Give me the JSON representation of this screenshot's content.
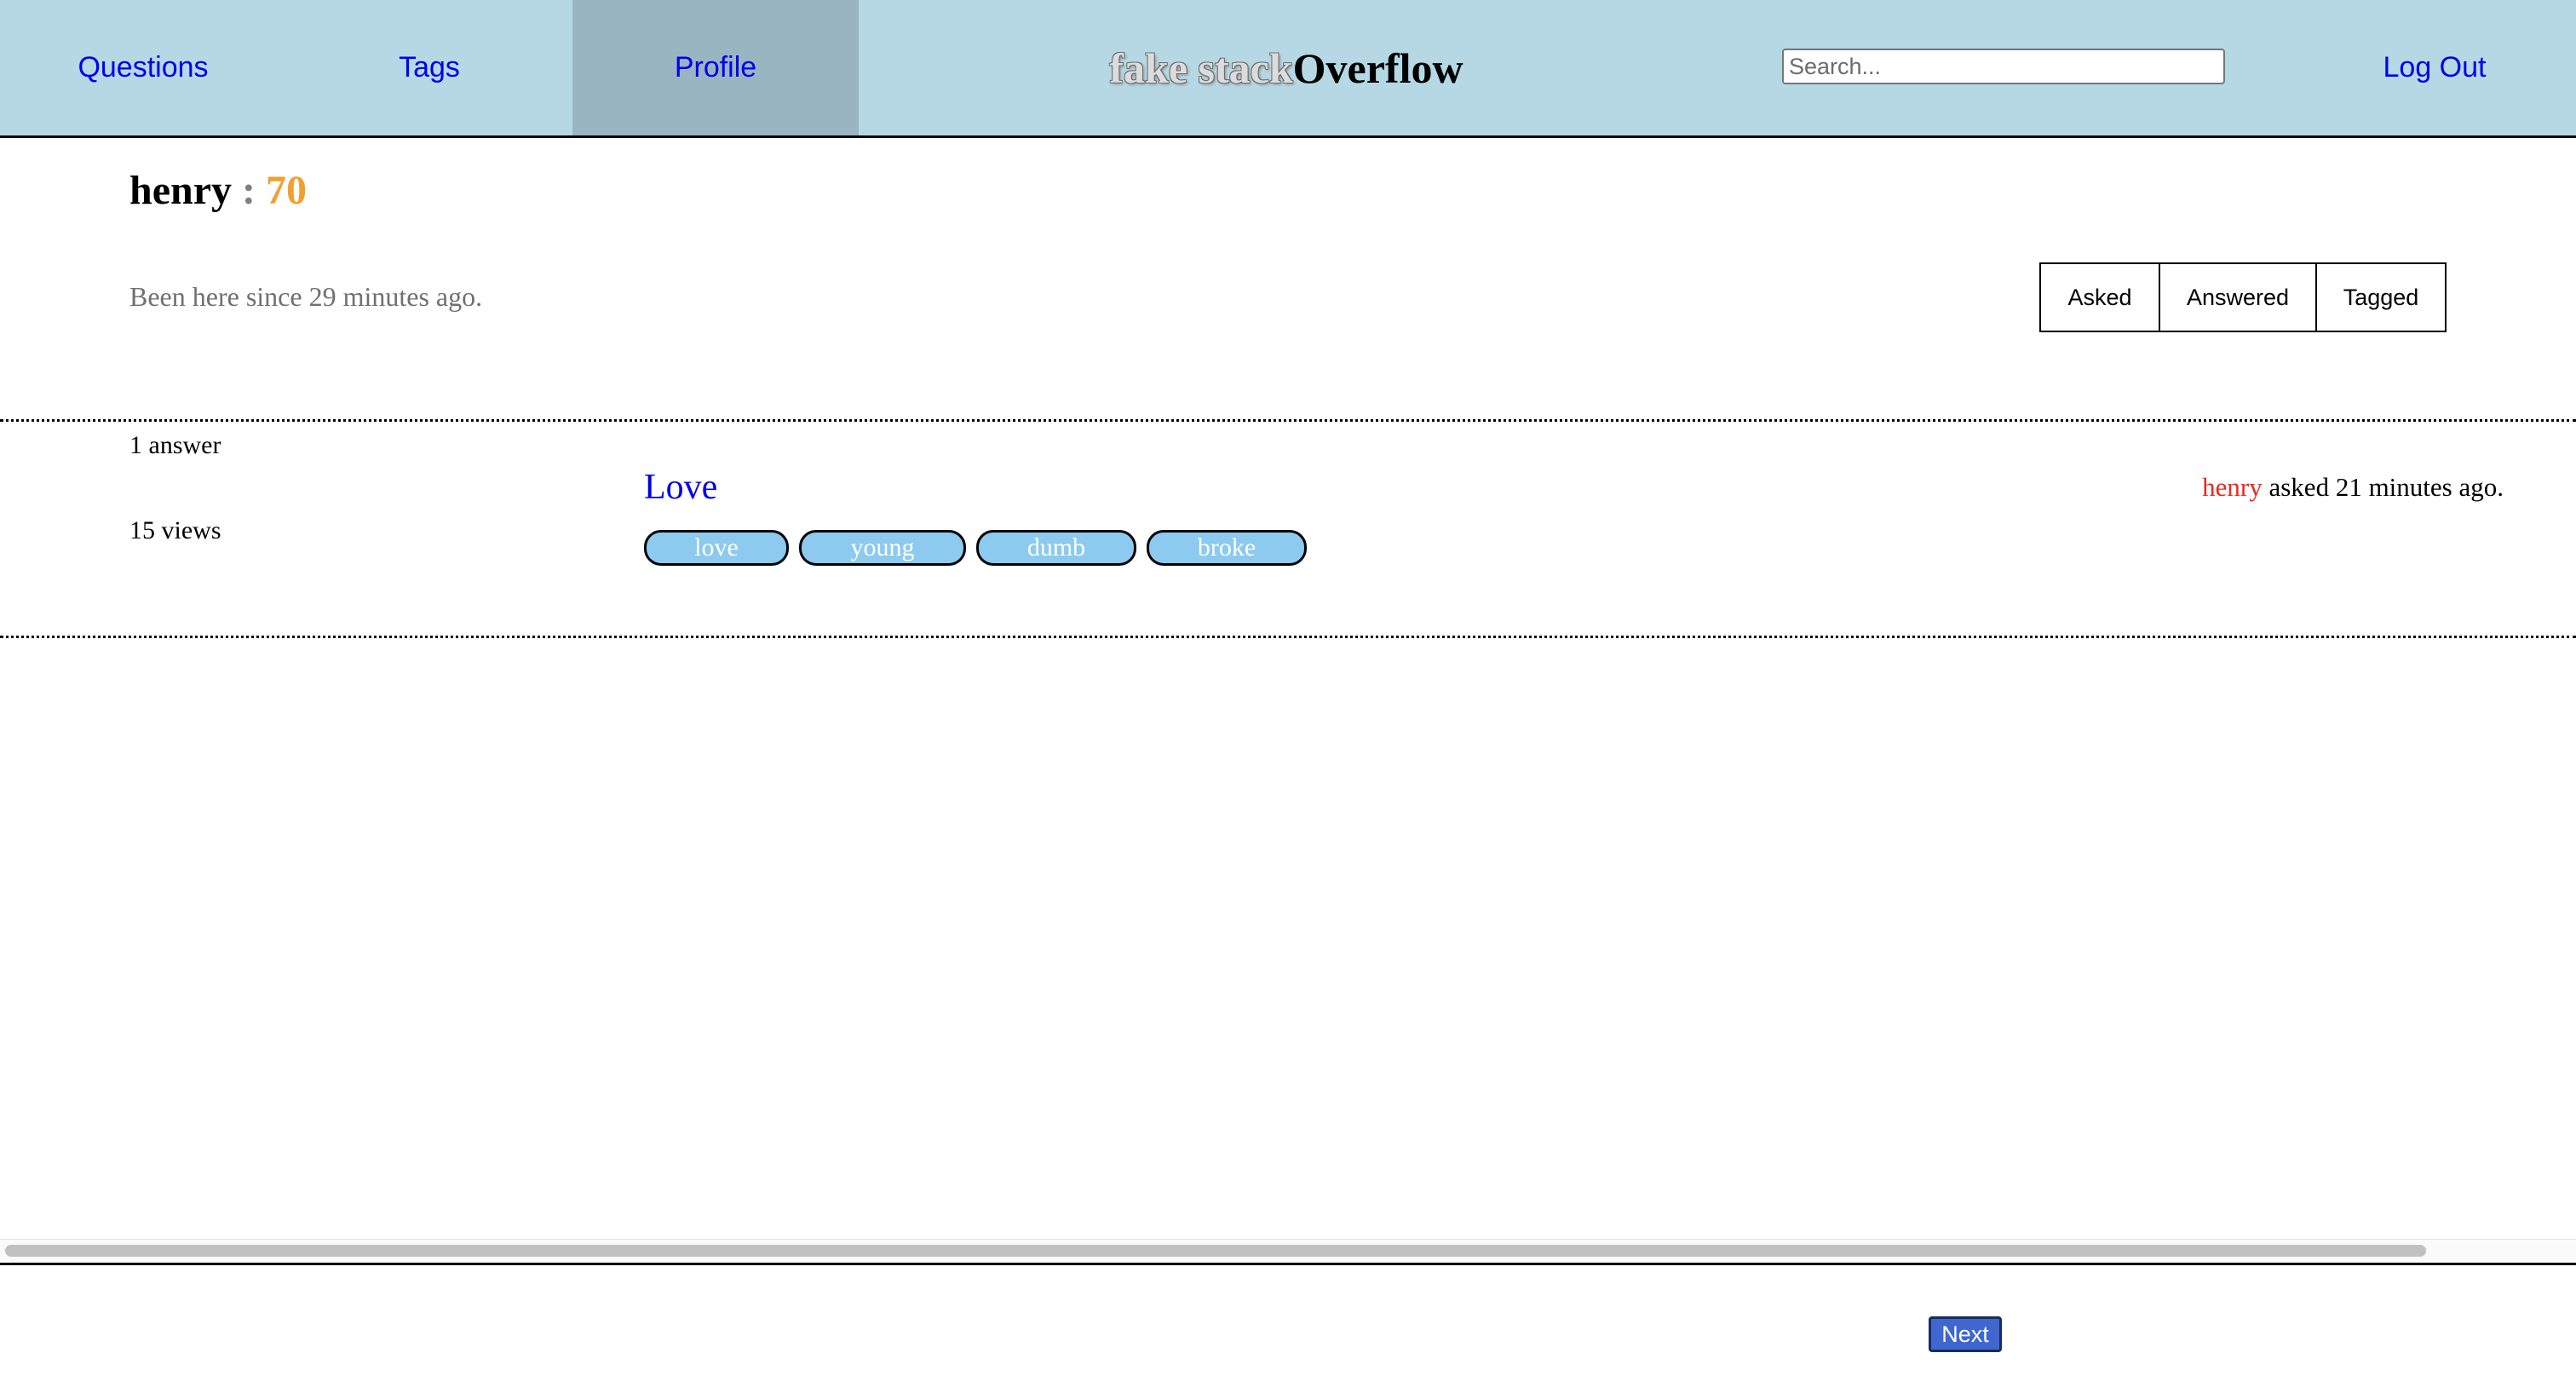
{
  "nav": {
    "questions": "Questions",
    "tags": "Tags",
    "profile": "Profile",
    "logout": "Log Out"
  },
  "logo": {
    "part1": "fake stack",
    "part2": "Overflow"
  },
  "search": {
    "placeholder": "Search..."
  },
  "profile": {
    "username": "henry",
    "separator": " : ",
    "reputation": "70",
    "member_since": "Been here since 29 minutes ago.",
    "tabs": [
      "Asked",
      "Answered",
      "Tagged"
    ]
  },
  "questions": [
    {
      "answers": "1 answer",
      "views": "15 views",
      "title": "Love",
      "tags": [
        "love",
        "young",
        "dumb",
        "broke"
      ],
      "author": "henry",
      "asked_text": " asked 21 minutes ago."
    }
  ],
  "pagination": {
    "next": "Next"
  },
  "colors": {
    "header_bg": "#b5d8e4",
    "active_nav_bg": "#99b5c1",
    "link": "#0000ee",
    "reputation": "#f0a030",
    "author": "#e8281e",
    "tag_bg": "#8ccaf0",
    "next_button": "#4067cf"
  }
}
